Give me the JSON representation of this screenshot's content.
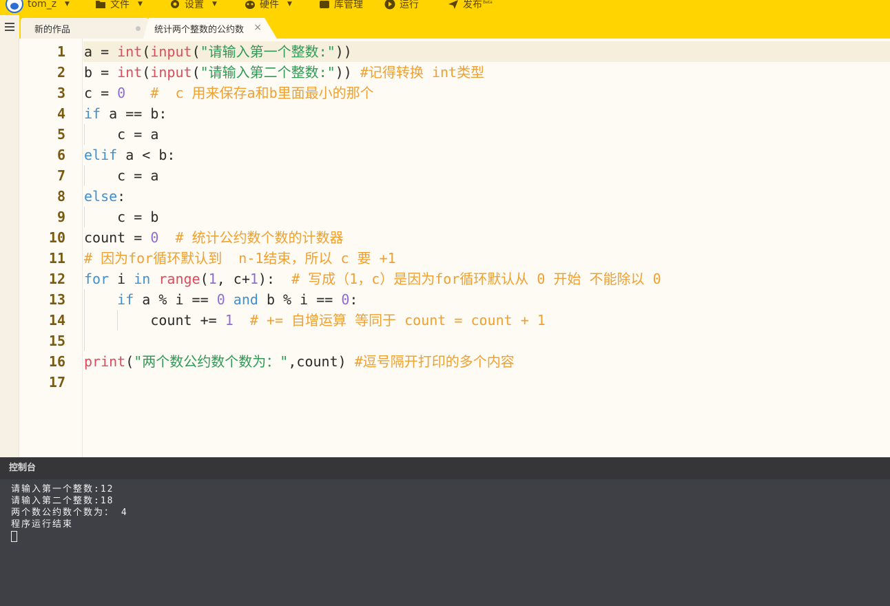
{
  "menubar": {
    "user": "tom_z",
    "file": "文件",
    "settings": "设置",
    "hardware": "硬件",
    "library": "库管理",
    "run": "运行",
    "publish": "发布",
    "publish_badge": "Beta"
  },
  "tabs": {
    "new_work": "新的作品",
    "current": "统计两个整数的公约数",
    "close": "×"
  },
  "editor": {
    "line_numbers": [
      "1",
      "2",
      "3",
      "4",
      "5",
      "6",
      "7",
      "8",
      "9",
      "10",
      "11",
      "12",
      "13",
      "14",
      "15",
      "16",
      "17"
    ],
    "lines": [
      "a = int(input(\"请输入第一个整数:\"))",
      "b = int(input(\"请输入第二个整数:\")) #记得转换 int类型",
      "c = 0   #  c 用来保存a和b里面最小的那个",
      "if a == b:",
      "    c = a",
      "elif a < b:",
      "    c = a",
      "else:",
      "    c = b",
      "count = 0  # 统计公约数个数的计数器",
      "# 因为for循环默认到  n-1结束，所以 c 要 +1",
      "for i in range(1, c+1):  # 写成（1，c）是因为for循环默认从 0 开始 不能除以 0",
      "    if a % i == 0 and b % i == 0:",
      "        count += 1  # += 自增运算 等同于 count = count + 1",
      "",
      "print(\"两个数公约数个数为：\",count) #逗号隔开打印的多个内容",
      ""
    ]
  },
  "console": {
    "title": "控制台",
    "output": [
      "请输入第一个整数:12",
      "请输入第二个整数:18",
      "两个数公约数个数为： 4",
      "程序运行结束"
    ]
  },
  "colors": {
    "accent": "#ffd400",
    "keyword": "#3d8fd6",
    "builtin": "#e14a5c",
    "string": "#2e9a56",
    "number": "#8f6ad9",
    "comment": "#f0a030"
  }
}
